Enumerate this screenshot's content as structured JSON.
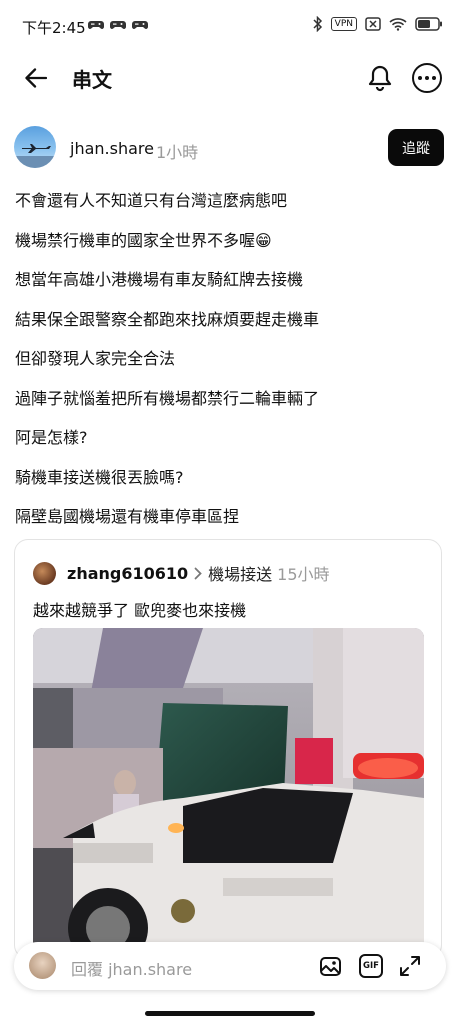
{
  "status_bar": {
    "time": "下午2:45",
    "left_icons": [
      "gamepad-icon",
      "gamepad-icon",
      "gamepad-icon"
    ],
    "right_icons": [
      "bluetooth-icon",
      "vpn-icon",
      "no-sim-icon",
      "wifi-icon",
      "battery-icon"
    ],
    "vpn_label": "VPN"
  },
  "header": {
    "title": "串文",
    "back_icon": "arrow-left-icon",
    "bell_icon": "bell-icon",
    "more_icon": "more-horizontal-icon"
  },
  "post": {
    "author": "jhan.share",
    "time": "1小時",
    "follow_label": "追蹤",
    "lines": [
      "不會還有人不知道只有台灣這麼病態吧",
      "機場禁行機車的國家全世界不多喔😁",
      "想當年高雄小港機場有車友騎紅牌去接機",
      "結果保全跟警察全都跑來找麻煩要趕走機車",
      "但卻發現人家完全合法",
      "過陣子就惱羞把所有機場都禁行二輪車輛了",
      "阿是怎樣?",
      "騎機車接送機很丟臉嗎?",
      "隔壁島國機場還有機車停車區捏"
    ]
  },
  "quoted_post": {
    "author": "zhang610610",
    "topic": "機場接送",
    "time": "15小時",
    "text": "越來越競爭了 歐兜麥也來接機",
    "image_description_icon": "photo-icon"
  },
  "reply_bar": {
    "placeholder": "回覆 jhan.share",
    "icons": [
      "image-icon",
      "gif-icon",
      "expand-icon"
    ],
    "gif_label": "GIF"
  },
  "colors": {
    "text": "#111111",
    "muted": "#9a9a9a",
    "follow_bg": "#0a0a0a",
    "police_light": "#e63030"
  }
}
